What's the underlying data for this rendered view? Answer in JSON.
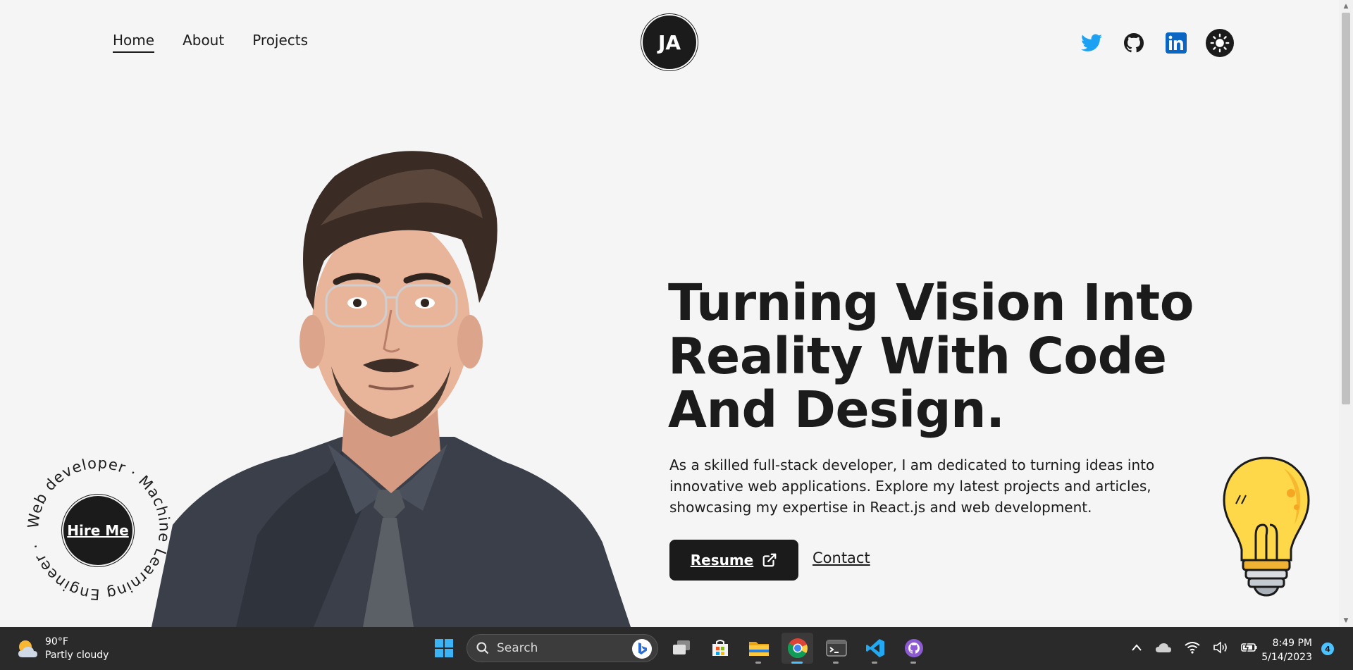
{
  "nav": {
    "items": [
      {
        "label": "Home",
        "active": true
      },
      {
        "label": "About",
        "active": false
      },
      {
        "label": "Projects",
        "active": false
      }
    ]
  },
  "logo": {
    "initials": "JA"
  },
  "socials": [
    "twitter-icon",
    "github-icon",
    "linkedin-icon",
    "sun-icon"
  ],
  "hero": {
    "headline": "Turning Vision Into Reality With Code And Design.",
    "description": "As a skilled full-stack developer, I am dedicated to turning ideas into innovative web applications. Explore my latest projects and articles, showcasing my expertise in React.js and web development.",
    "resume_label": "Resume",
    "contact_label": "Contact"
  },
  "hire": {
    "label": "Hire Me",
    "ring_text": "Web developer · Machine Learning Engineer · "
  },
  "taskbar": {
    "weather_temp": "90°F",
    "weather_desc": "Partly cloudy",
    "search_placeholder": "Search",
    "time": "8:49 PM",
    "date": "5/14/2023",
    "notification_count": "4"
  },
  "colors": {
    "page_bg": "#f5f5f5",
    "dark": "#1b1b1b",
    "twitter": "#1da1f2",
    "linkedin": "#0a66c2",
    "taskbar_bg": "#2a2a2a",
    "accent": "#4cc2ff"
  }
}
